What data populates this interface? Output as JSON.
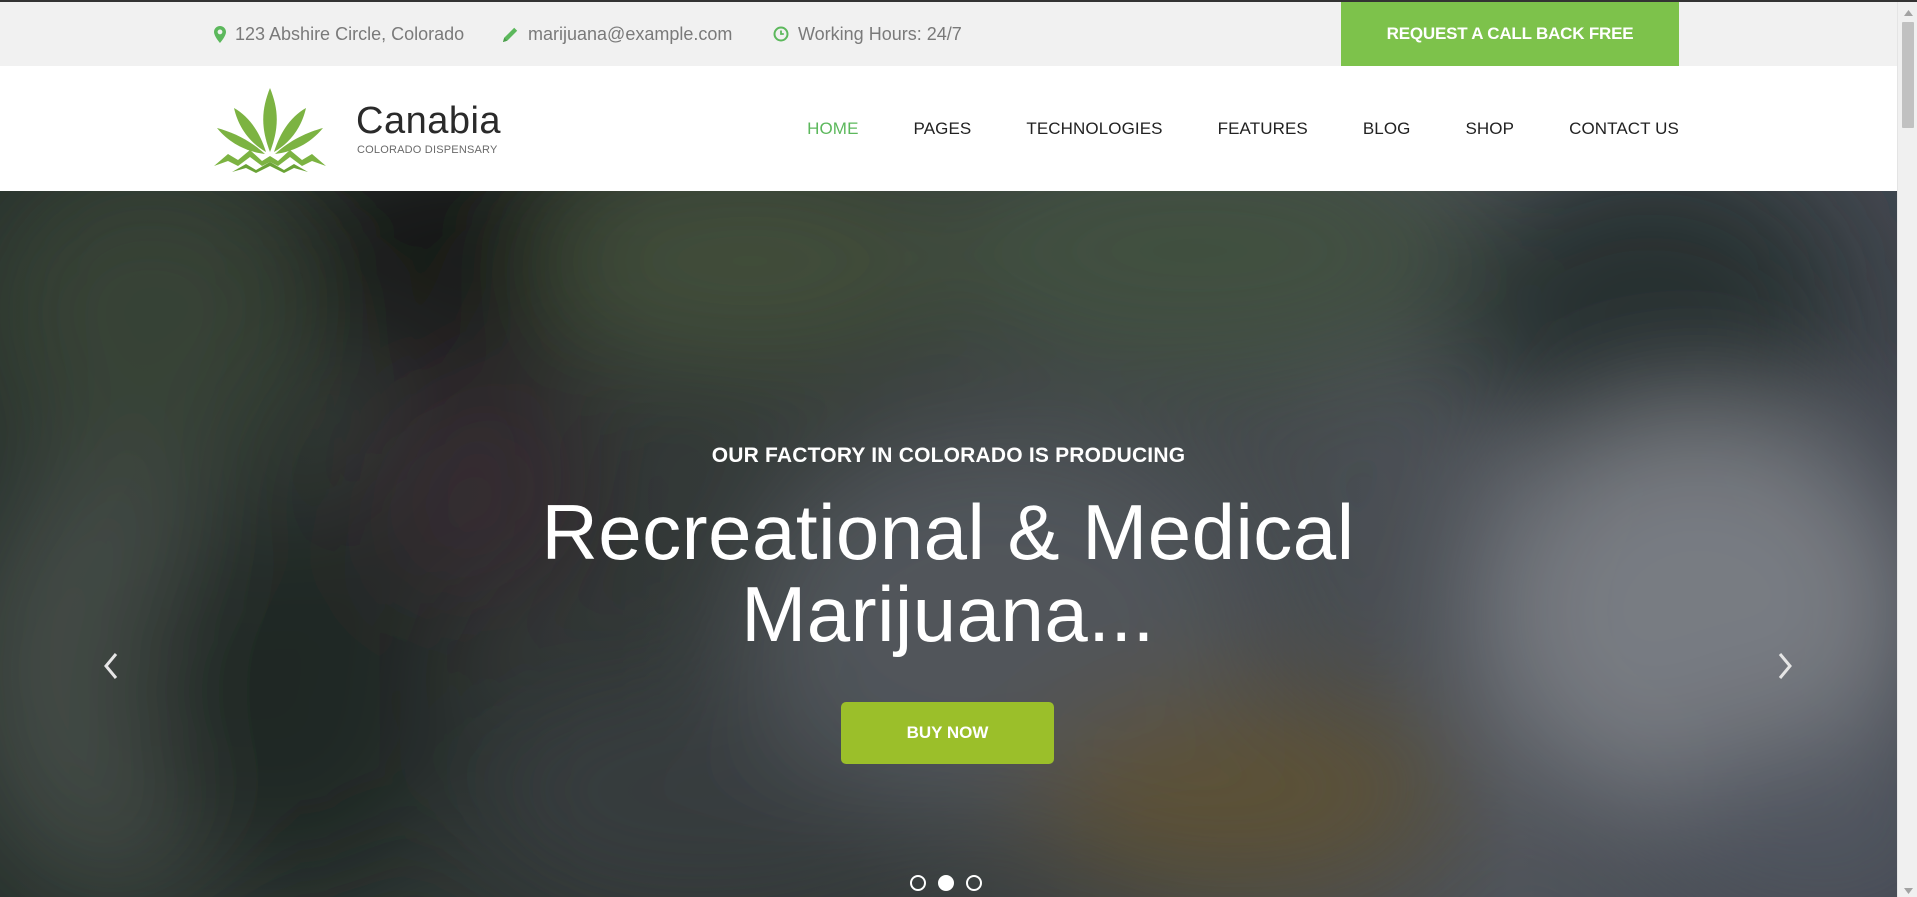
{
  "topbar": {
    "address": "123 Abshire Circle, Colorado",
    "email": "marijuana@example.com",
    "hours": "Working Hours: 24/7",
    "callback_label": "REQUEST A CALL BACK FREE",
    "address_icon": "map-pin-icon",
    "email_icon": "pencil-icon",
    "hours_icon": "clock-icon"
  },
  "header": {
    "brand_name": "Canabia",
    "brand_tagline": "COLORADO DISPENSARY",
    "logo_icon": "cannabis-leaf-icon"
  },
  "nav": {
    "items": [
      {
        "label": "HOME",
        "active": true
      },
      {
        "label": "PAGES",
        "active": false
      },
      {
        "label": "TECHNOLOGIES",
        "active": false
      },
      {
        "label": "FEATURES",
        "active": false
      },
      {
        "label": "BLOG",
        "active": false
      },
      {
        "label": "SHOP",
        "active": false
      },
      {
        "label": "CONTACT US",
        "active": false
      }
    ]
  },
  "hero": {
    "subtitle": "OUR FACTORY IN COLORADO IS PRODUCING",
    "title": "Recreational & Medical Marijuana...",
    "button_label": "BUY NOW",
    "slides_total": 3,
    "active_slide": 2
  },
  "colors": {
    "accent_green": "#7dc24b",
    "nav_active": "#5cb85c",
    "buy_button": "#9bbf2a",
    "logo_leaf": "#7cb342"
  }
}
